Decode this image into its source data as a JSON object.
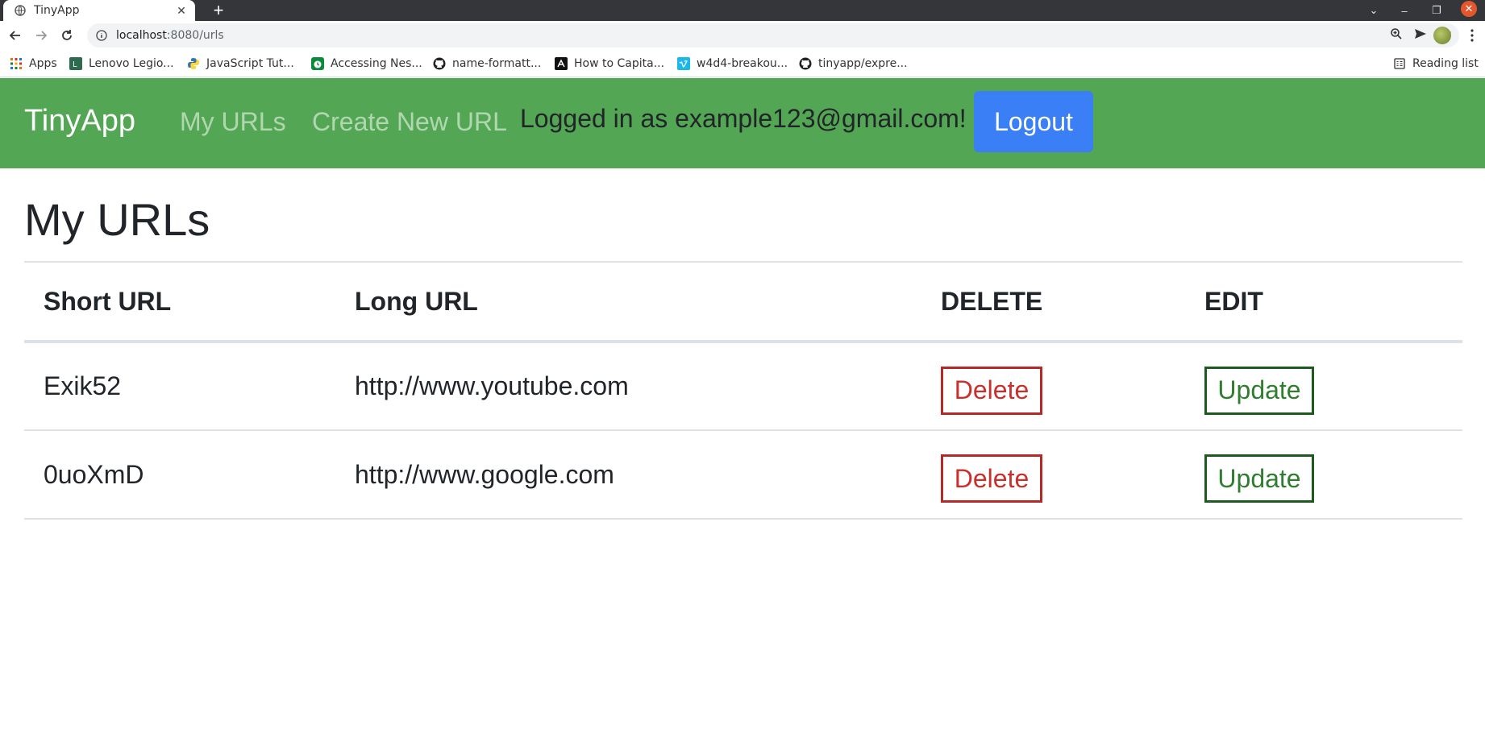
{
  "browser": {
    "tab_title": "TinyApp",
    "url_host": "localhost",
    "url_rest": ":8080/urls",
    "bookmarks": [
      {
        "label": "Apps",
        "icon": "apps-grid-icon"
      },
      {
        "label": "Lenovo Legio...",
        "icon": "lenovo-icon"
      },
      {
        "label": "JavaScript Tut...",
        "icon": "python-icon"
      },
      {
        "label": "Accessing Nes...",
        "icon": "green-clock-icon"
      },
      {
        "label": "name-formatt...",
        "icon": "github-icon"
      },
      {
        "label": "How to Capita...",
        "icon": "dark-logo-icon"
      },
      {
        "label": "w4d4-breakou...",
        "icon": "vimeo-icon"
      },
      {
        "label": "tinyapp/expre...",
        "icon": "github-icon"
      }
    ],
    "reading_list": "Reading list"
  },
  "navbar": {
    "brand": "TinyApp",
    "my_urls": "My URLs",
    "create_new": "Create New URL",
    "logged_in": "Logged in as example123@gmail.com!",
    "logout": "Logout",
    "color": "#53a653",
    "logout_color": "#3a7ff6"
  },
  "main": {
    "title": "My URLs",
    "columns": [
      "Short URL",
      "Long URL",
      "DELETE",
      "EDIT"
    ],
    "rows": [
      {
        "short": "Exik52",
        "long": "http://www.youtube.com",
        "delete": "Delete",
        "update": "Update"
      },
      {
        "short": "0uoXmD",
        "long": "http://www.google.com",
        "delete": "Delete",
        "update": "Update"
      }
    ]
  }
}
